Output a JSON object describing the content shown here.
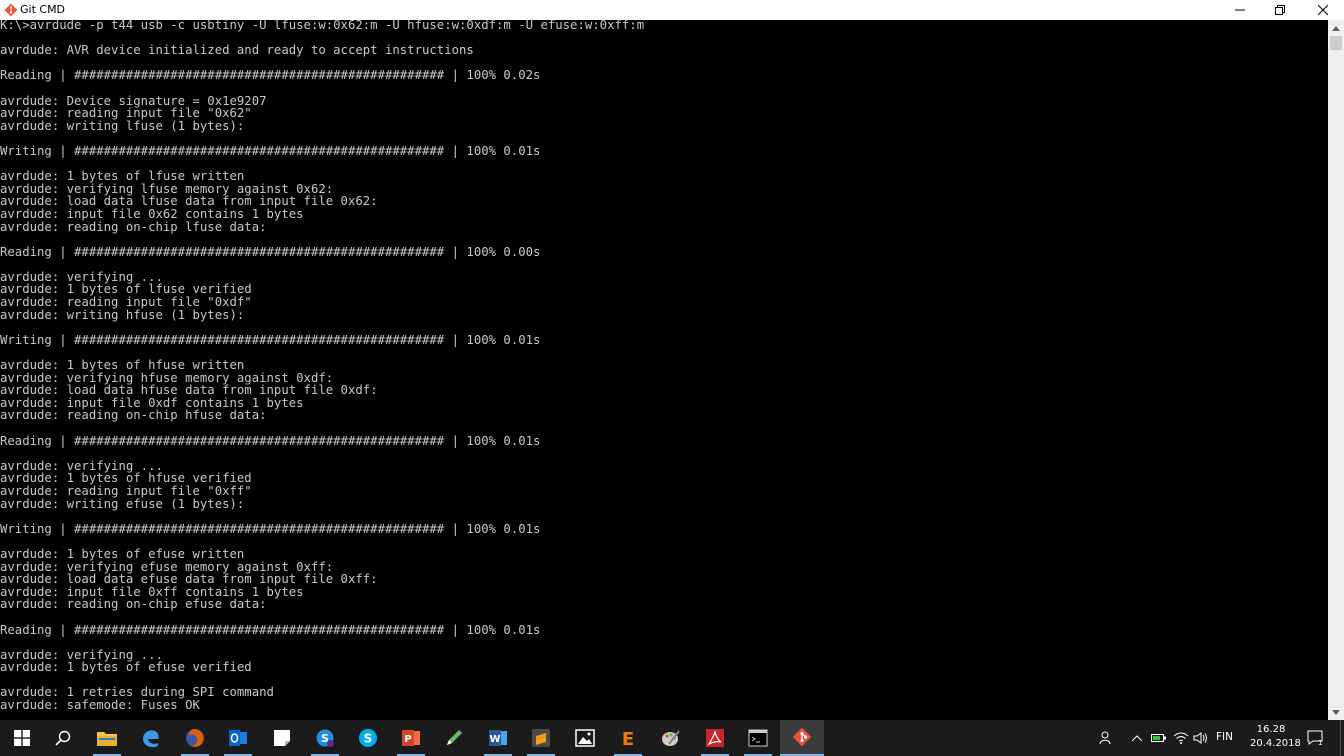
{
  "window": {
    "title": "Git CMD",
    "minimize_glyph": "—",
    "maximize_glyph": "❐",
    "close_glyph": "✕"
  },
  "console": {
    "lines": [
      "K:\\>avrdude -p t44 usb -c usbtiny -U lfuse:w:0x62:m -U hfuse:w:0xdf:m -U efuse:w:0xff:m",
      "",
      "avrdude: AVR device initialized and ready to accept instructions",
      "",
      "Reading | ################################################## | 100% 0.02s",
      "",
      "avrdude: Device signature = 0x1e9207",
      "avrdude: reading input file \"0x62\"",
      "avrdude: writing lfuse (1 bytes):",
      "",
      "Writing | ################################################## | 100% 0.01s",
      "",
      "avrdude: 1 bytes of lfuse written",
      "avrdude: verifying lfuse memory against 0x62:",
      "avrdude: load data lfuse data from input file 0x62:",
      "avrdude: input file 0x62 contains 1 bytes",
      "avrdude: reading on-chip lfuse data:",
      "",
      "Reading | ################################################## | 100% 0.00s",
      "",
      "avrdude: verifying ...",
      "avrdude: 1 bytes of lfuse verified",
      "avrdude: reading input file \"0xdf\"",
      "avrdude: writing hfuse (1 bytes):",
      "",
      "Writing | ################################################## | 100% 0.01s",
      "",
      "avrdude: 1 bytes of hfuse written",
      "avrdude: verifying hfuse memory against 0xdf:",
      "avrdude: load data hfuse data from input file 0xdf:",
      "avrdude: input file 0xdf contains 1 bytes",
      "avrdude: reading on-chip hfuse data:",
      "",
      "Reading | ################################################## | 100% 0.01s",
      "",
      "avrdude: verifying ...",
      "avrdude: 1 bytes of hfuse verified",
      "avrdude: reading input file \"0xff\"",
      "avrdude: writing efuse (1 bytes):",
      "",
      "Writing | ################################################## | 100% 0.01s",
      "",
      "avrdude: 1 bytes of efuse written",
      "avrdude: verifying efuse memory against 0xff:",
      "avrdude: load data efuse data from input file 0xff:",
      "avrdude: input file 0xff contains 1 bytes",
      "avrdude: reading on-chip efuse data:",
      "",
      "Reading | ################################################## | 100% 0.01s",
      "",
      "avrdude: verifying ...",
      "avrdude: 1 bytes of efuse verified",
      "",
      "avrdude: 1 retries during SPI command",
      "avrdude: safemode: Fuses OK"
    ]
  },
  "taskbar": {
    "items": [
      {
        "name": "start",
        "icon": "windows-logo-icon",
        "color": "#ffffff"
      },
      {
        "name": "search",
        "icon": "search-icon",
        "color": "#ffffff"
      },
      {
        "name": "file-explorer",
        "icon": "folder-icon",
        "color": "#f8c542"
      },
      {
        "name": "edge",
        "icon": "edge-icon",
        "color": "#3c9ae8"
      },
      {
        "name": "firefox",
        "icon": "firefox-icon",
        "color": "#e66000"
      },
      {
        "name": "outlook",
        "icon": "outlook-icon",
        "color": "#0a64c8"
      },
      {
        "name": "sticky-notes",
        "icon": "sticky-notes-icon",
        "color": "#ffffff"
      },
      {
        "name": "skype-business",
        "icon": "skype-business-icon",
        "color": "#1f8fe0"
      },
      {
        "name": "skype",
        "icon": "skype-icon",
        "color": "#00aff0"
      },
      {
        "name": "powerpoint",
        "icon": "powerpoint-icon",
        "color": "#d24726"
      },
      {
        "name": "pen-app",
        "icon": "pen-icon",
        "color": "#6fb36c"
      },
      {
        "name": "word",
        "icon": "word-icon",
        "color": "#2b579a"
      },
      {
        "name": "sublime-text",
        "icon": "sublime-icon",
        "color": "#f59a1b"
      },
      {
        "name": "photos",
        "icon": "photos-icon",
        "color": "#ffffff"
      },
      {
        "name": "eagle",
        "icon": "eagle-icon",
        "color": "#f07d00"
      },
      {
        "name": "paint",
        "icon": "paint-icon",
        "color": "#cccccc"
      },
      {
        "name": "acrobat",
        "icon": "acrobat-icon",
        "color": "#c9252a"
      },
      {
        "name": "command-prompt",
        "icon": "terminal-icon",
        "color": "#cccccc"
      },
      {
        "name": "git-cmd",
        "icon": "git-icon",
        "color": "#f05033"
      }
    ],
    "tray": {
      "language": "FIN",
      "time": "16.28",
      "date": "20.4.2018",
      "notification_count": "1"
    }
  }
}
